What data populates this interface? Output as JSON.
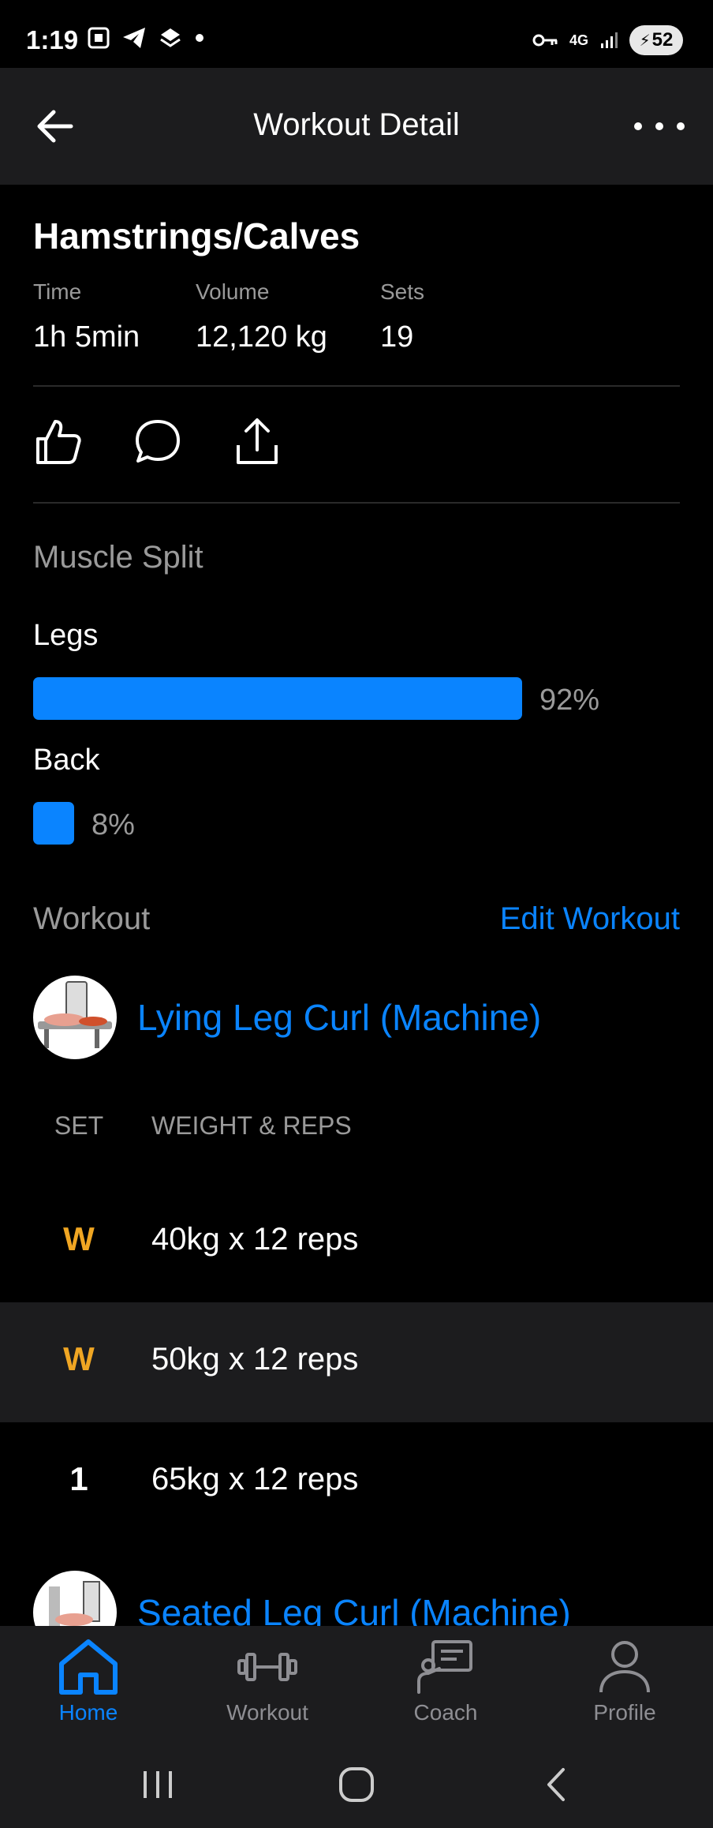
{
  "status_bar": {
    "time": "1:19",
    "battery": "52",
    "network": "4G"
  },
  "header": {
    "title": "Workout Detail"
  },
  "workout": {
    "title": "Hamstrings/Calves",
    "stats": [
      {
        "label": "Time",
        "value": "1h 5min"
      },
      {
        "label": "Volume",
        "value": "12,120 kg"
      },
      {
        "label": "Sets",
        "value": "19"
      }
    ]
  },
  "muscle_split": {
    "label": "Muscle Split",
    "items": [
      {
        "name": "Legs",
        "percent": 92,
        "percent_label": "92%"
      },
      {
        "name": "Back",
        "percent": 8,
        "percent_label": "8%"
      }
    ]
  },
  "workout_section": {
    "label": "Workout",
    "edit_label": "Edit Workout",
    "exercises": [
      {
        "name": "Lying Leg Curl (Machine)",
        "columns": {
          "set": "SET",
          "weight_reps": "WEIGHT & REPS"
        },
        "sets": [
          {
            "set": "W",
            "type": "warmup",
            "detail": "40kg x 12 reps"
          },
          {
            "set": "W",
            "type": "warmup",
            "detail": "50kg x 12 reps"
          },
          {
            "set": "1",
            "type": "normal",
            "detail": "65kg x 12 reps"
          }
        ]
      },
      {
        "name": "Seated Leg Curl (Machine)"
      }
    ]
  },
  "bottom_nav": [
    {
      "label": "Home",
      "active": true
    },
    {
      "label": "Workout",
      "active": false
    },
    {
      "label": "Coach",
      "active": false
    },
    {
      "label": "Profile",
      "active": false
    }
  ],
  "colors": {
    "accent": "#0a84ff",
    "warmup": "#f0a623",
    "surface": "#1c1c1e",
    "background": "#000000"
  }
}
